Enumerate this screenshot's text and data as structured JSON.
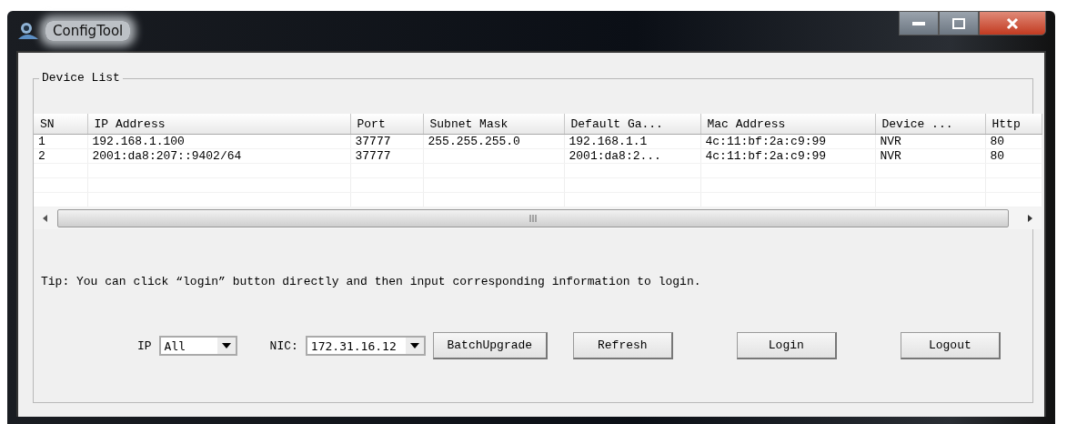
{
  "window": {
    "title": "ConfigTool"
  },
  "device_list": {
    "title": "Device List",
    "columns": [
      "SN",
      "IP Address",
      "Port",
      "Subnet Mask",
      "Default Ga...",
      "Mac Address",
      "Device ...",
      "Http"
    ],
    "rows": [
      [
        "1",
        "192.168.1.100",
        "37777",
        "255.255.255.0",
        "192.168.1.1",
        "4c:11:bf:2a:c9:99",
        "NVR",
        "80"
      ],
      [
        "2",
        "2001:da8:207::9402/64",
        "37777",
        null,
        "2001:da8:2...",
        "4c:11:bf:2a:c9:99",
        "NVR",
        "80"
      ]
    ]
  },
  "tip": "Tip: You can click “login” button directly and then input corresponding information to login.",
  "selectors": [
    {
      "label": "IP",
      "value": "All"
    },
    {
      "label": "NIC:",
      "value": "172.31.16.12"
    }
  ],
  "buttons": [
    "BatchUpgrade",
    "Refresh",
    "Login",
    "Logout"
  ]
}
